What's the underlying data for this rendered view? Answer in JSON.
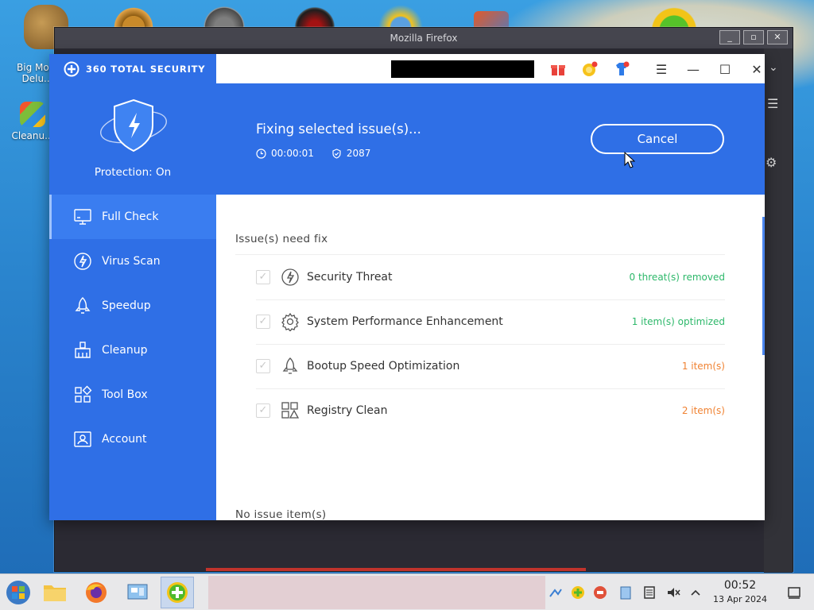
{
  "desktop": {
    "icons": [
      {
        "label": "Big Mo... Delu..."
      },
      {
        "label": "Cleanu..."
      }
    ],
    "background_firefox_title": "Mozilla Firefox"
  },
  "app": {
    "brand": "360 TOTAL SECURITY",
    "protection_status": "Protection: On",
    "nav": [
      {
        "label": "Full Check",
        "icon": "monitor-icon",
        "active": true
      },
      {
        "label": "Virus Scan",
        "icon": "virus-scan-icon",
        "active": false
      },
      {
        "label": "Speedup",
        "icon": "rocket-icon",
        "active": false
      },
      {
        "label": "Cleanup",
        "icon": "broom-icon",
        "active": false
      },
      {
        "label": "Tool Box",
        "icon": "toolbox-icon",
        "active": false
      },
      {
        "label": "Account",
        "icon": "account-icon",
        "active": false
      }
    ],
    "banner": {
      "title": "Fixing selected issue(s)...",
      "elapsed": "00:00:01",
      "count": "2087",
      "cancel_label": "Cancel"
    },
    "issues_title": "Issue(s) need fix",
    "issues": [
      {
        "label": "Security Threat",
        "status": "0 threat(s) removed",
        "status_color": "#2db86a",
        "icon": "lightning-icon"
      },
      {
        "label": "System Performance Enhancement",
        "status": "1 item(s) optimized",
        "status_color": "#2db86a",
        "icon": "gear-icon"
      },
      {
        "label": "Bootup Speed Optimization",
        "status": "1 item(s)",
        "status_color": "#f08232",
        "icon": "rocket-icon"
      },
      {
        "label": "Registry Clean",
        "status": "2 item(s)",
        "status_color": "#f08232",
        "icon": "registry-icon"
      }
    ],
    "no_issue_title": "No issue item(s)"
  },
  "taskbar": {
    "time": "00:52",
    "date": "13 Apr 2024"
  },
  "colors": {
    "accent": "#2f6fe6",
    "green": "#2db86a",
    "orange": "#f08232"
  }
}
